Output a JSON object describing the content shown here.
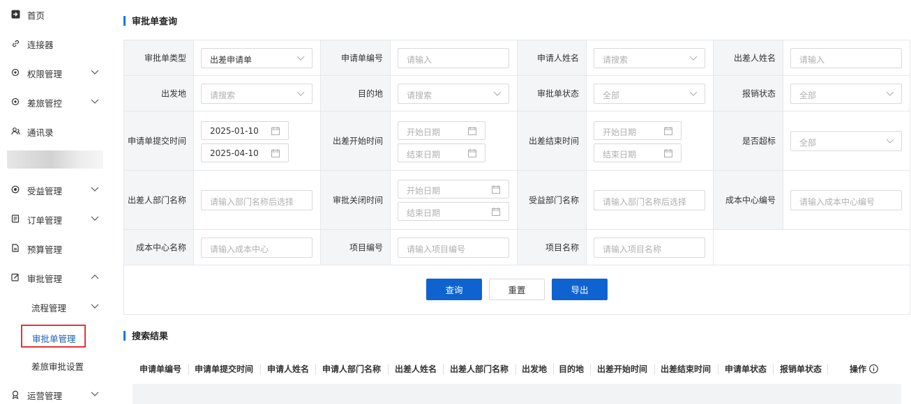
{
  "sidebar": {
    "items": [
      {
        "label": "首页",
        "icon": "home-icon"
      },
      {
        "label": "连接器",
        "icon": "link-icon"
      },
      {
        "label": "权限管理",
        "icon": "gear-icon"
      },
      {
        "label": "差旅管控",
        "icon": "gear-icon"
      },
      {
        "label": "通讯录",
        "icon": "contacts-icon"
      },
      {
        "label": "受益管理",
        "icon": "coin-icon"
      },
      {
        "label": "订单管理",
        "icon": "document-icon"
      },
      {
        "label": "预算管理",
        "icon": "file-icon"
      },
      {
        "label": "审批管理",
        "icon": "edit-icon"
      },
      {
        "label": "流程管理"
      },
      {
        "label": "审批单管理"
      },
      {
        "label": "差旅审批设置"
      },
      {
        "label": "运营管理",
        "icon": "award-icon"
      }
    ]
  },
  "query": {
    "title": "审批单查询",
    "fields": {
      "type_label": "审批单类型",
      "type_value": "出差申请单",
      "no_label": "申请单编号",
      "no_ph": "请输入",
      "applicant_label": "申请人姓名",
      "applicant_ph": "请搜索",
      "traveler_label": "出差人姓名",
      "traveler_ph": "请输入",
      "from_label": "出发地",
      "from_ph": "请搜索",
      "to_label": "目的地",
      "to_ph": "请搜索",
      "status_label": "审批单状态",
      "status_value": "全部",
      "reimb_label": "报销状态",
      "reimb_value": "全部",
      "submit_label": "申请单提交时间",
      "submit_start": "2025-01-10",
      "submit_end": "2025-04-10",
      "trip_start_label": "出差开始时间",
      "start_ph": "开始日期",
      "end_ph": "结束日期",
      "trip_end_label": "出差结束时间",
      "over_label": "是否超标",
      "over_value": "全部",
      "dept_label": "出差人部门名称",
      "dept_ph": "请输入部门名称后选择",
      "close_label": "审批关闭时间",
      "benefit_label": "受益部门名称",
      "benefit_ph": "请输入部门名称后选择",
      "cc_no_label": "成本中心编号",
      "cc_no_ph": "请输入成本中心编号",
      "cc_name_label": "成本中心名称",
      "cc_name_ph": "请输入成本中心",
      "proj_no_label": "项目编号",
      "proj_no_ph": "请输入项目编号",
      "proj_name_label": "项目名称",
      "proj_name_ph": "请输入项目名称"
    },
    "buttons": {
      "search": "查询",
      "reset": "重置",
      "export": "导出"
    }
  },
  "results": {
    "title": "搜索结果",
    "columns": [
      "申请单编号",
      "申请单提交时间",
      "申请人姓名",
      "申请人部门名称",
      "出差人姓名",
      "出差人部门名称",
      "出发地",
      "目的地",
      "出差开始时间",
      "出差结束时间",
      "申请单状态",
      "报销单状态",
      "操作"
    ]
  },
  "colors": {
    "primary": "#0f63d0",
    "accent_bar": "#1a73e8",
    "highlight_border": "#e03535",
    "active_text": "#1a5fb4"
  }
}
